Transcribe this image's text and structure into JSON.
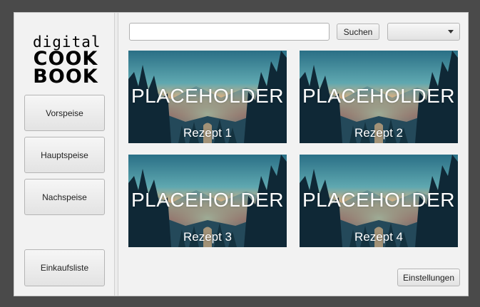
{
  "logo": {
    "line1": "digital",
    "line2": "COOK",
    "line3": "BOOK"
  },
  "sidebar": {
    "buttons": [
      {
        "label": "Vorspeise"
      },
      {
        "label": "Hauptspeise"
      },
      {
        "label": "Nachspeise"
      }
    ],
    "shopping_list": {
      "label": "Einkaufsliste"
    }
  },
  "search": {
    "value": "",
    "placeholder": "",
    "button_label": "Suchen"
  },
  "filter": {
    "selected": ""
  },
  "recipes": [
    {
      "image_text": "PLACEHOLDER",
      "name": "Rezept 1"
    },
    {
      "image_text": "PLACEHOLDER",
      "name": "Rezept 2"
    },
    {
      "image_text": "PLACEHOLDER",
      "name": "Rezept 3"
    },
    {
      "image_text": "PLACEHOLDER",
      "name": "Rezept 4"
    }
  ],
  "settings": {
    "label": "Einstellungen"
  },
  "colors": {
    "background": "#4a4a4a",
    "window": "#f2f2f2"
  }
}
